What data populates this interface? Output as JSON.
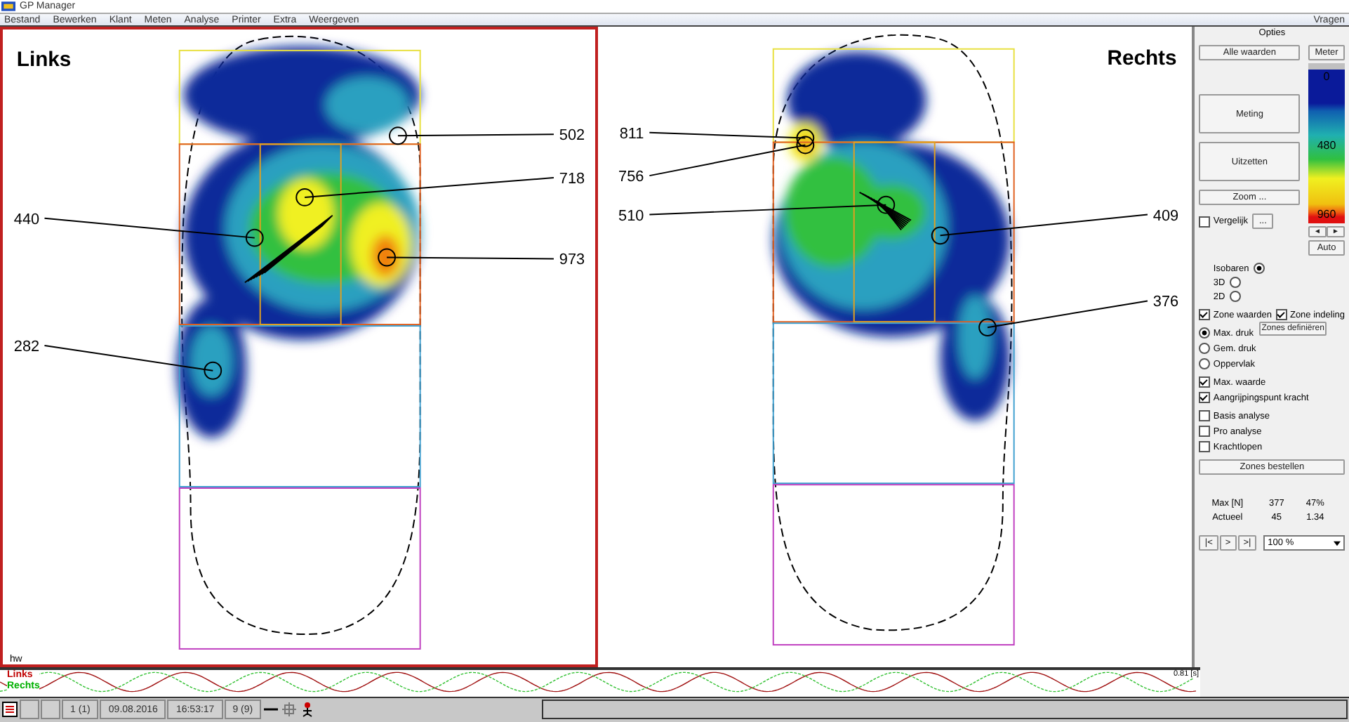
{
  "window": {
    "title": "GP Manager"
  },
  "menu": [
    "Bestand",
    "Bewerken",
    "Klant",
    "Meten",
    "Analyse",
    "Printer",
    "Extra",
    "Weergeven"
  ],
  "help_menu": "Vragen",
  "plates": [
    {
      "title": "Links",
      "selected": true,
      "footer": "hw",
      "values": [
        "502",
        "718",
        "440",
        "973",
        "282"
      ]
    },
    {
      "title": "Rechts",
      "selected": false,
      "values": [
        "811",
        "756",
        "510",
        "409",
        "376"
      ]
    }
  ],
  "side_panel": {
    "title": "Opties",
    "all_values_button": "Alle waarden",
    "scale_button": "Meter",
    "measure_button": "Meting",
    "extend_button": "Uitzetten",
    "zoom_button": "Zoom ...",
    "compare": {
      "label": "Vergelijk",
      "checked": false
    },
    "more_button": "...",
    "scale_labels": [
      "0",
      "480",
      "960"
    ],
    "scale_arrows": [
      "◄",
      "►"
    ],
    "auto_button": "Auto",
    "view_modes": [
      {
        "label": "Isobaren",
        "selected": true
      },
      {
        "label": "3D",
        "selected": false
      },
      {
        "label": "2D",
        "selected": false
      }
    ],
    "zone_checks": [
      {
        "label": "Zone waarden",
        "checked": true
      },
      {
        "label": "Zone indeling",
        "checked": true
      }
    ],
    "zones_button": "Zones definiëren",
    "pressure_modes": [
      {
        "label": "Max. druk",
        "selected": true
      },
      {
        "label": "Gem. druk",
        "selected": false
      },
      {
        "label": "Oppervlak",
        "selected": false
      }
    ],
    "display_checks": [
      {
        "label": "Max. waarde",
        "checked": true
      },
      {
        "label": "Aangrijpingspunt kracht",
        "checked": true
      }
    ],
    "analysis_checks": [
      {
        "label": "Basis analyse",
        "checked": false
      },
      {
        "label": "Pro analyse",
        "checked": false
      },
      {
        "label": "Krachtlopen",
        "checked": false
      }
    ],
    "order_button": "Zones bestellen",
    "stats": [
      [
        "Max [N]",
        "377",
        "47%"
      ],
      [
        "Actueel",
        "45",
        "1.34"
      ]
    ],
    "nav_buttons": [
      "|<",
      ">",
      ">|"
    ],
    "zoom_select": "100 %"
  },
  "gait": {
    "labels": [
      {
        "text": "Links",
        "color": "#c00000"
      },
      {
        "text": "Rechts",
        "color": "#00b000"
      }
    ],
    "duration": "0.81 [s]"
  },
  "status_bar": {
    "cells": [
      "1 (1)",
      "09.08.2016",
      "16:53:17",
      "9 (9)"
    ]
  }
}
